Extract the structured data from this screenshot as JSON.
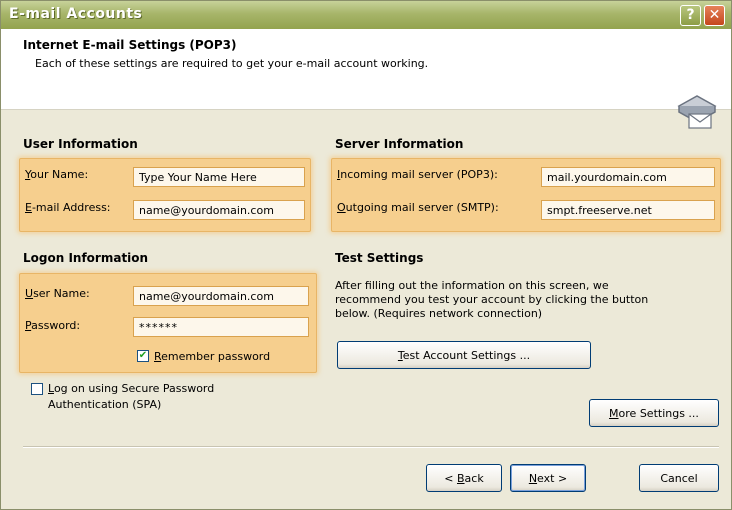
{
  "window": {
    "title": "E-mail Accounts",
    "help_label": "?",
    "close_label": "✕"
  },
  "header": {
    "title": "Internet E-mail Settings (POP3)",
    "subtitle": "Each of these settings are required to get your e-mail account working.",
    "icon": "envelope-server-icon"
  },
  "user_info": {
    "title": "User Information",
    "name_label_u": "Y",
    "name_label_rest": "our Name:",
    "name_value": "Type Your Name Here",
    "email_label_u": "E",
    "email_label_rest": "-mail Address:",
    "email_value": "name@yourdomain.com"
  },
  "server_info": {
    "title": "Server Information",
    "incoming_label_u": "I",
    "incoming_label_rest": "ncoming mail server (POP3):",
    "incoming_value": "mail.yourdomain.com",
    "outgoing_label_u": "O",
    "outgoing_label_rest": "utgoing mail server (SMTP):",
    "outgoing_value": "smpt.freeserve.net"
  },
  "logon_info": {
    "title": "Logon Information",
    "user_label_u": "U",
    "user_label_rest": "ser Name:",
    "user_value": "name@yourdomain.com",
    "password_label_u": "P",
    "password_label_rest": "assword:",
    "password_value": "******",
    "remember_u": "R",
    "remember_rest": "emember password",
    "remember_checked": true,
    "spa_u": "L",
    "spa_line1_rest": "og on using Secure Password",
    "spa_line2": "Authentication (SPA)",
    "spa_checked": false
  },
  "test_settings": {
    "title": "Test Settings",
    "line1": "After filling out the information on this screen, we",
    "line2": "recommend you test your account by clicking the button",
    "line3": "below. (Requires network connection)",
    "button_u": "T",
    "button_rest": "est Account Settings ..."
  },
  "buttons": {
    "more_u": "M",
    "more_rest": "ore Settings ...",
    "back_pre": "< ",
    "back_u": "B",
    "back_rest": "ack",
    "next_u": "N",
    "next_rest": "ext >",
    "cancel": "Cancel"
  },
  "colors": {
    "highlight": "#f6cf8e",
    "titlebar": "#a7b56a",
    "close": "#c4461c"
  }
}
